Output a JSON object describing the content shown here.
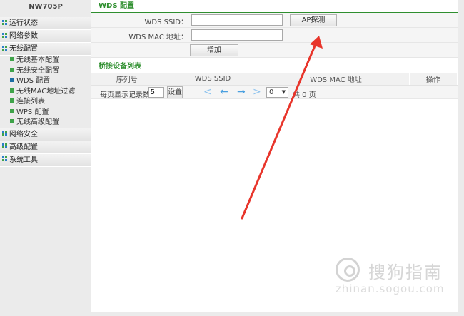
{
  "sidebar": {
    "brand": "NW705P",
    "groups": [
      {
        "label": "运行状态"
      },
      {
        "label": "网络参数"
      },
      {
        "label": "无线配置"
      },
      {
        "label": "网络安全"
      },
      {
        "label": "高级配置"
      },
      {
        "label": "系统工具"
      }
    ],
    "wireless_items": [
      {
        "label": "无线基本配置"
      },
      {
        "label": "无线安全配置"
      },
      {
        "label": "WDS 配置"
      },
      {
        "label": "无线MAC地址过滤"
      },
      {
        "label": "连接列表"
      },
      {
        "label": "WPS 配置"
      },
      {
        "label": "无线高级配置"
      }
    ]
  },
  "wds": {
    "title": "WDS 配置",
    "ssid_label": "WDS SSID：",
    "ssid_value": "",
    "ap_scan_label": "AP探测",
    "mac_label": "WDS MAC 地址：",
    "mac_value": "",
    "add_label": "增加"
  },
  "bridge": {
    "title": "桥接设备列表",
    "columns": [
      "序列号",
      "WDS SSID",
      "WDS MAC 地址",
      "操作"
    ]
  },
  "pager": {
    "per_page_label": "每页显示记录数",
    "per_page_value": "5",
    "set_label": "设置",
    "first_icon": "<",
    "prev_icon": "←",
    "next_icon": "→",
    "last_icon": ">",
    "page_value": "0",
    "total_text": "共 0 页"
  },
  "watermark": {
    "brand_text": "搜狗指南",
    "url": "zhinan.sogou.com"
  },
  "colors": {
    "accent_green": "#2f8f2f",
    "annotation_arrow": "#e8352b",
    "pager_blue": "#4aa0e0"
  }
}
